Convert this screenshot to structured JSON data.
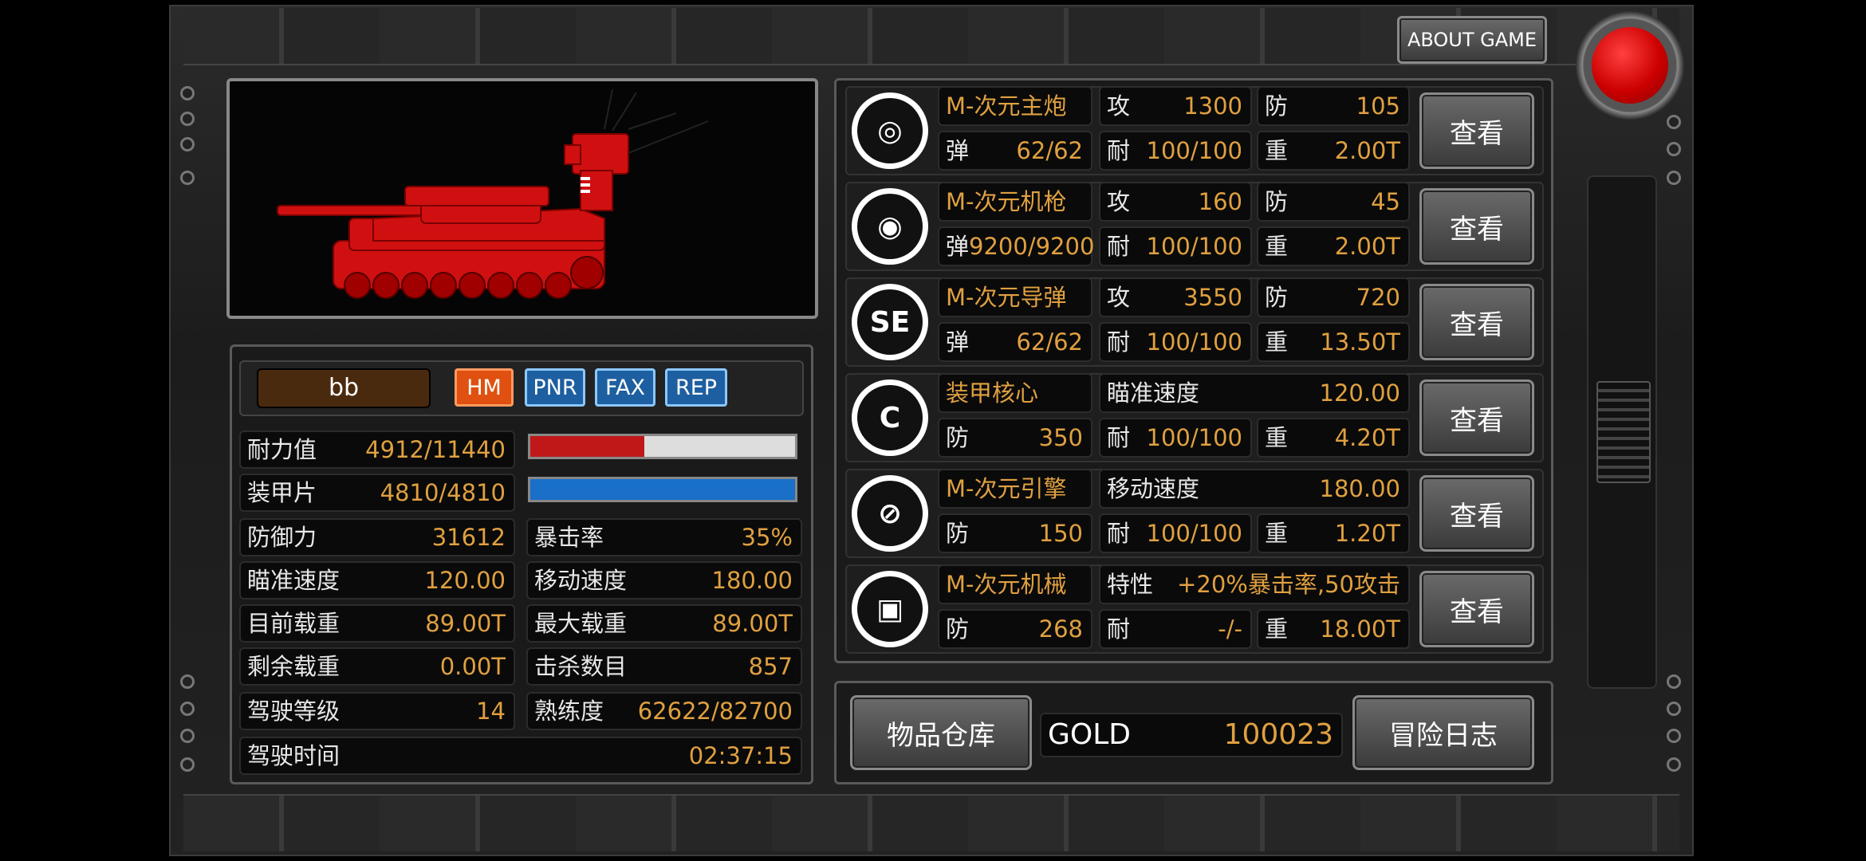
{
  "header": {
    "about_label": "ABOUT GAME"
  },
  "tank": {
    "name": "bb",
    "tags": [
      "HM",
      "PNR",
      "FAX",
      "REP"
    ],
    "color": "#d01010"
  },
  "stats": {
    "durability": {
      "label": "耐力值",
      "value": "4912/11440",
      "fraction": 0.43
    },
    "armor": {
      "label": "装甲片",
      "value": "4810/4810",
      "fraction": 1.0
    },
    "grid": [
      {
        "label": "防御力",
        "value": "31612"
      },
      {
        "label": "暴击率",
        "value": "35%"
      },
      {
        "label": "瞄准速度",
        "value": "120.00"
      },
      {
        "label": "移动速度",
        "value": "180.00"
      },
      {
        "label": "目前载重",
        "value": "89.00T"
      },
      {
        "label": "最大载重",
        "value": "89.00T"
      },
      {
        "label": "剩余载重",
        "value": "0.00T"
      },
      {
        "label": "击杀数目",
        "value": "857"
      },
      {
        "label": "驾驶等级",
        "value": "14"
      },
      {
        "label": "熟练度",
        "value": "62622/82700"
      }
    ],
    "drive_time": {
      "label": "驾驶时间",
      "value": "02:37:15"
    }
  },
  "equipment": [
    {
      "icon": "main-cannon-icon",
      "name": "M-次元主炮",
      "row1": [
        [
          "攻",
          "1300"
        ],
        [
          "防",
          "105"
        ]
      ],
      "row2": [
        [
          "弹",
          "62/62"
        ],
        [
          "耐",
          "100/100"
        ],
        [
          "重",
          "2.00T"
        ]
      ],
      "view": "查看"
    },
    {
      "icon": "machine-gun-icon",
      "name": "M-次元机枪",
      "row1": [
        [
          "攻",
          "160"
        ],
        [
          "防",
          "45"
        ]
      ],
      "row2": [
        [
          "弹",
          "9200/9200"
        ],
        [
          "耐",
          "100/100"
        ],
        [
          "重",
          "2.00T"
        ]
      ],
      "view": "查看"
    },
    {
      "icon": "missile-icon",
      "name": "M-次元导弹",
      "row1": [
        [
          "攻",
          "3550"
        ],
        [
          "防",
          "720"
        ]
      ],
      "row2": [
        [
          "弹",
          "62/62"
        ],
        [
          "耐",
          "100/100"
        ],
        [
          "重",
          "13.50T"
        ]
      ],
      "view": "查看"
    },
    {
      "icon": "armor-core-icon",
      "name": "装甲核心",
      "row1": [
        [
          "瞄准速度",
          "120.00"
        ]
      ],
      "row2": [
        [
          "防",
          "350"
        ],
        [
          "耐",
          "100/100"
        ],
        [
          "重",
          "4.20T"
        ]
      ],
      "view": "查看"
    },
    {
      "icon": "engine-icon",
      "name": "M-次元引擎",
      "row1": [
        [
          "移动速度",
          "180.00"
        ]
      ],
      "row2": [
        [
          "防",
          "150"
        ],
        [
          "耐",
          "100/100"
        ],
        [
          "重",
          "1.20T"
        ]
      ],
      "view": "查看"
    },
    {
      "icon": "mechanism-icon",
      "name": "M-次元机械",
      "row1": [
        [
          "特性",
          "+20%暴击率,50攻击"
        ]
      ],
      "row2": [
        [
          "防",
          "268"
        ],
        [
          "耐",
          "-/-"
        ],
        [
          "重",
          "18.00T"
        ]
      ],
      "view": "查看"
    }
  ],
  "footer": {
    "warehouse_label": "物品仓库",
    "gold_label": "GOLD",
    "gold_value": "100023",
    "log_label": "冒险日志"
  }
}
